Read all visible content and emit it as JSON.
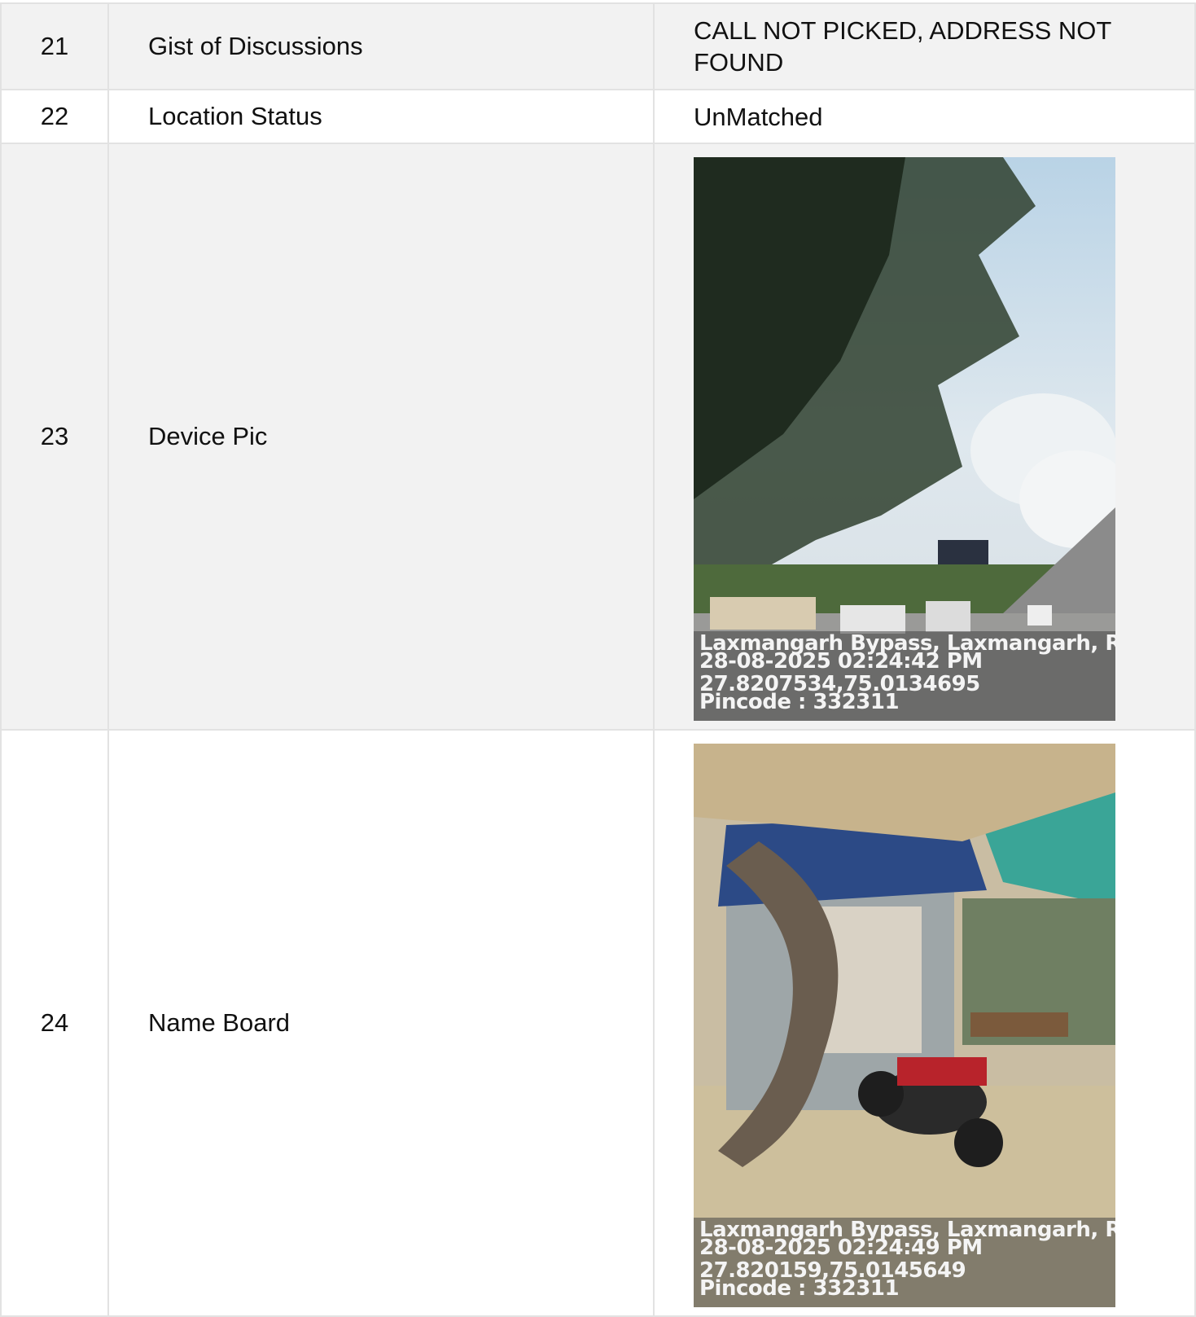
{
  "rows": [
    {
      "num": "21",
      "label": "Gist of Discussions",
      "value": "CALL NOT PICKED, ADDRESS NOT FOUND"
    },
    {
      "num": "22",
      "label": "Location Status",
      "value": "UnMatched"
    },
    {
      "num": "23",
      "label": "Device Pic",
      "photo": {
        "address": "Laxmangarh Bypass, Laxmangarh, Rajasthan",
        "datetime": "28-08-2025 02:24:42 PM",
        "coords": "27.8207534,75.0134695",
        "pincode": "Pincode : 332311"
      }
    },
    {
      "num": "24",
      "label": "Name Board",
      "photo": {
        "address": "Laxmangarh Bypass, Laxmangarh, Rajasthan",
        "datetime": "28-08-2025 02:24:49 PM",
        "coords": "27.820159,75.0145649",
        "pincode": "Pincode : 332311"
      }
    }
  ]
}
